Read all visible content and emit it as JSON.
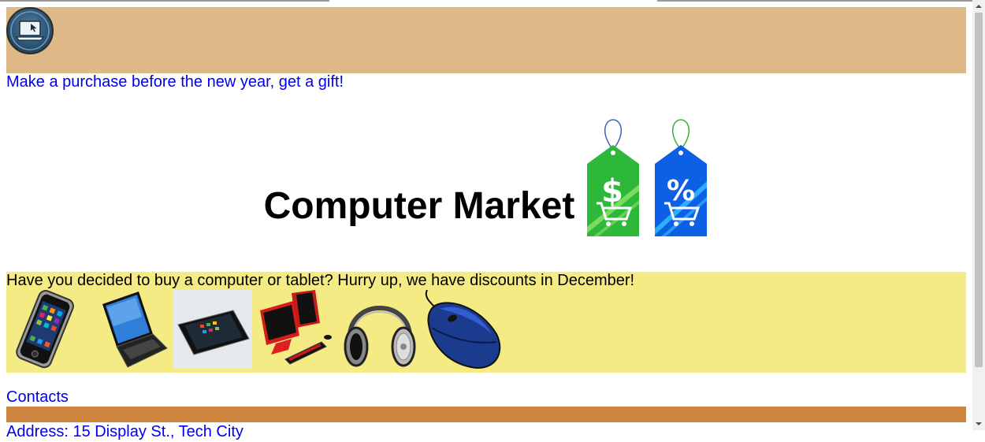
{
  "header": {
    "logo_icon": "laptop-cursor-icon",
    "background_color": "#deb887"
  },
  "promo_link": "Make a purchase before the new year, get a gift!",
  "title": "Computer Market",
  "tags": [
    {
      "icon": "dollar-cart-tag-icon",
      "color": "#2eb83a"
    },
    {
      "icon": "percent-cart-tag-icon",
      "color": "#0d5fe6"
    }
  ],
  "offer": {
    "text": "Have you decided to buy a computer or tablet? Hurry up, we have discounts in December!",
    "background_color": "#f5eb84",
    "products": [
      "smartphone-icon",
      "laptop-icon",
      "tablet-icon",
      "desktop-computer-icon",
      "headphones-icon",
      "mouse-icon"
    ]
  },
  "contacts_link": "Contacts",
  "footer_bar_color": "#cd853f",
  "address": "Address: 15 Display St., Tech City"
}
